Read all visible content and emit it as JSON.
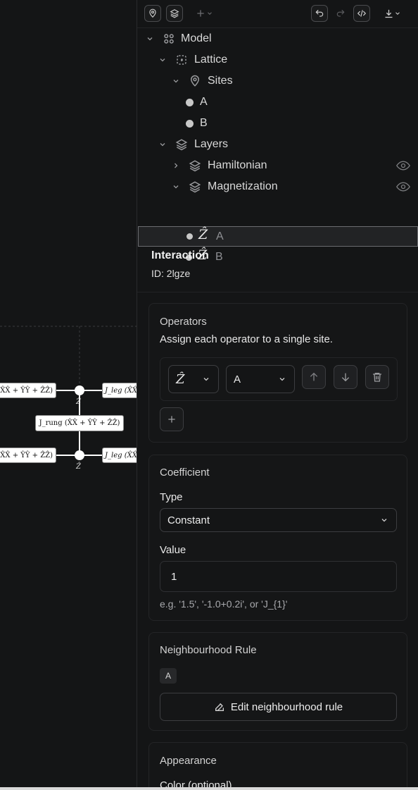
{
  "canvas": {
    "term_left_top": "X̂X̂ + ŶŶ + ẐẐ)",
    "term_right_top": "J_leg (X̂X̂",
    "term_rung": "J_rung (X̂X̂ + ŶŶ + ẐẐ)",
    "term_left_bottom": "X̂X̂ + ŶŶ + ẐẐ)",
    "term_right_bottom": "J_leg (X̂X̂",
    "node_label_top": "Ẑ",
    "node_label_bottom": "Ẑ"
  },
  "toolbar": {
    "icons": [
      "map-pin-icon",
      "layers-icon",
      "plus-icon",
      "chevron-down-icon",
      "undo-icon",
      "redo-icon",
      "code-icon",
      "download-icon",
      "chevron-down-icon"
    ]
  },
  "tree": {
    "model": "Model",
    "lattice": "Lattice",
    "sites": "Sites",
    "site_a": "A",
    "site_b": "B",
    "layers": "Layers",
    "hamiltonian": "Hamiltonian",
    "magnetization": "Magnetization",
    "op1_symbol": "Ẑ",
    "op1_site": "A",
    "op2_symbol": "Ẑ",
    "op2_site": "B"
  },
  "interaction": {
    "title": "Interaction",
    "id": "ID: 2lgze"
  },
  "operators": {
    "title": "Operators",
    "description": "Assign each operator to a single site.",
    "operator_value": "Ẑ",
    "site_value": "A"
  },
  "coefficient": {
    "title": "Coefficient",
    "type_label": "Type",
    "type_value": "Constant",
    "value_label": "Value",
    "value": "1",
    "hint": "e.g. '1.5', '-1.0+0.2i', or 'J_{1}'"
  },
  "neighbourhood": {
    "title": "Neighbourhood Rule",
    "chip": "A",
    "edit_button": "Edit neighbourhood rule"
  },
  "appearance": {
    "title": "Appearance",
    "color_label": "Color (optional)"
  },
  "colors": {
    "background": "#121314",
    "panel": "#141516",
    "selection": "#222325",
    "text": "#e6e6e6"
  }
}
